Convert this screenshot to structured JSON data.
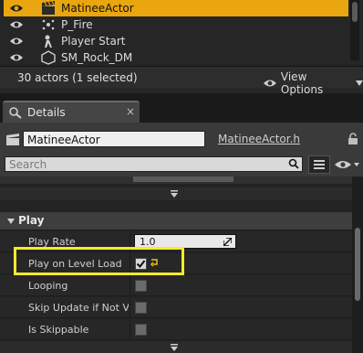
{
  "outliner": {
    "actors": [
      {
        "name": "MatineeActor",
        "icon": "matinee-clapper-icon",
        "selected": true
      },
      {
        "name": "P_Fire",
        "icon": "particle-system-icon",
        "selected": false
      },
      {
        "name": "Player Start",
        "icon": "player-start-icon",
        "selected": false
      },
      {
        "name": "SM_Rock_DM",
        "icon": "static-mesh-icon",
        "selected": false
      }
    ],
    "status": "30 actors (1 selected)",
    "view_options": "View Options"
  },
  "details_tab": {
    "label": "Details",
    "close": "×"
  },
  "details": {
    "object_name": "MatineeActor",
    "class_link": "MatineeActor.h",
    "search_placeholder": "Search"
  },
  "play_section": {
    "title": "Play",
    "properties": [
      {
        "label": "Play Rate",
        "type": "number",
        "value": "1.0"
      },
      {
        "label": "Play on Level Load",
        "type": "checkbox",
        "checked": true,
        "highlighted": true
      },
      {
        "label": "Looping",
        "type": "checkbox",
        "checked": false
      },
      {
        "label": "Skip Update if Not Visible",
        "type": "checkbox",
        "checked": false
      },
      {
        "label": "Is Skippable",
        "type": "checkbox",
        "checked": false
      }
    ]
  },
  "colors": {
    "selection": "#e9a60f",
    "highlight_box": "#f3ea2e",
    "panel_bg": "#3a3a3a"
  }
}
